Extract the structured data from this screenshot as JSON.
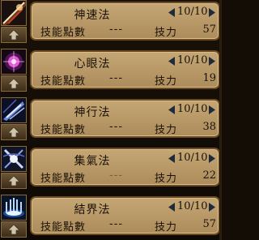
{
  "skills": [
    {
      "name": "神速法",
      "level": "10/10",
      "cost_label": "技能點數",
      "cost_value": "---",
      "power_label": "技力",
      "power_value": "57",
      "icon": "lightning-strike-icon"
    },
    {
      "name": "心眼法",
      "level": "10/10",
      "cost_label": "技能點數",
      "cost_value": "---",
      "power_label": "技力",
      "power_value": "19",
      "icon": "glowing-eye-orb-icon"
    },
    {
      "name": "神行法",
      "level": "10/10",
      "cost_label": "技能點數",
      "cost_value": "---",
      "power_label": "技力",
      "power_value": "38",
      "icon": "winged-boot-icon"
    },
    {
      "name": "集氣法",
      "level": "10/10",
      "cost_label": "技能點數",
      "cost_value": "---",
      "power_label": "技力",
      "power_value": "22",
      "icon": "energy-gather-icon"
    },
    {
      "name": "結界法",
      "level": "10/10",
      "cost_label": "技能點數",
      "cost_value": "---",
      "power_label": "技力",
      "power_value": "57",
      "icon": "barrier-icon"
    }
  ],
  "colors": {
    "panel_bg": "#130d05",
    "box_fill": "#bfa06f",
    "box_border": "#6d4b22",
    "text": "#1a1208",
    "arrow": "#1f2a3a"
  }
}
